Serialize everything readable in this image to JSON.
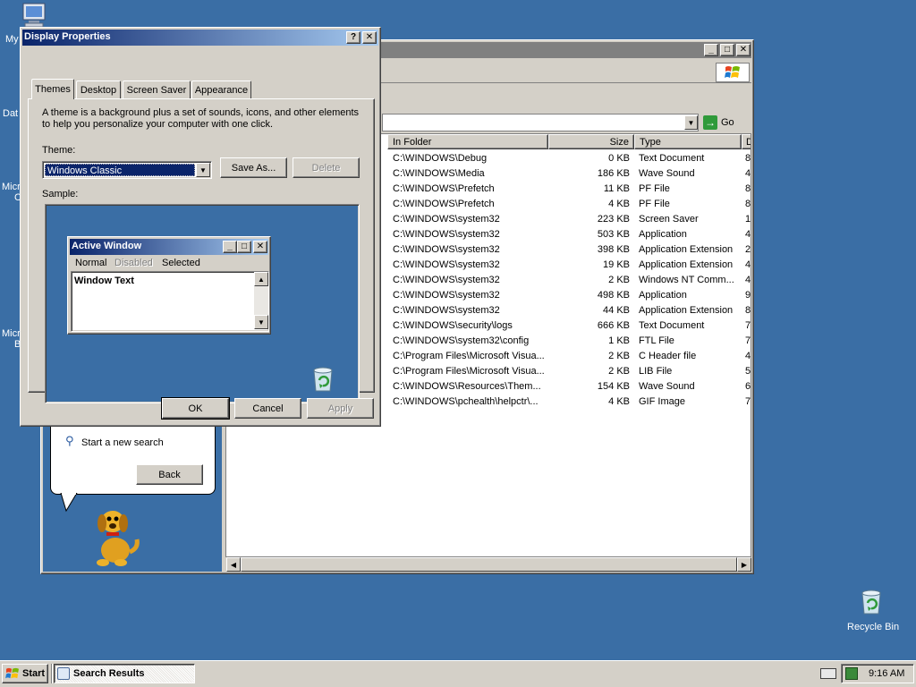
{
  "desktop": {
    "icons": [
      {
        "label": "My",
        "name": "my-computer"
      },
      {
        "label": "Dat",
        "name": "data"
      },
      {
        "label": "Micr",
        "label2": "C",
        "name": "microsoft-1"
      },
      {
        "label": "Micr",
        "label2": "B",
        "name": "microsoft-2"
      },
      {
        "label": "Recycle Bin",
        "name": "recycle-bin"
      }
    ]
  },
  "search_window": {
    "go_label": "Go",
    "columns": {
      "in_folder": "In Folder",
      "size": "Size",
      "type": "Type",
      "d": "D"
    },
    "rows": [
      {
        "folder": "C:\\WINDOWS\\Debug",
        "size": "0 KB",
        "type": "Text Document",
        "d": "8"
      },
      {
        "folder": "C:\\WINDOWS\\Media",
        "size": "186 KB",
        "type": "Wave Sound",
        "d": "4"
      },
      {
        "folder": "C:\\WINDOWS\\Prefetch",
        "size": "11 KB",
        "type": "PF File",
        "d": "8"
      },
      {
        "folder": "C:\\WINDOWS\\Prefetch",
        "size": "4 KB",
        "type": "PF File",
        "d": "8"
      },
      {
        "folder": "C:\\WINDOWS\\system32",
        "size": "223 KB",
        "type": "Screen Saver",
        "d": "1"
      },
      {
        "folder": "C:\\WINDOWS\\system32",
        "size": "503 KB",
        "type": "Application",
        "d": "4"
      },
      {
        "folder": "C:\\WINDOWS\\system32",
        "size": "398 KB",
        "type": "Application Extension",
        "d": "2"
      },
      {
        "folder": "C:\\WINDOWS\\system32",
        "size": "19 KB",
        "type": "Application Extension",
        "d": "4"
      },
      {
        "folder": "C:\\WINDOWS\\system32",
        "size": "2 KB",
        "type": "Windows NT Comm...",
        "d": "4"
      },
      {
        "folder": "C:\\WINDOWS\\system32",
        "size": "498 KB",
        "type": "Application",
        "d": "9"
      },
      {
        "folder": "C:\\WINDOWS\\system32",
        "size": "44 KB",
        "type": "Application Extension",
        "d": "8"
      },
      {
        "folder": "C:\\WINDOWS\\security\\logs",
        "size": "666 KB",
        "type": "Text Document",
        "d": "7"
      },
      {
        "folder": "C:\\WINDOWS\\system32\\config",
        "size": "1 KB",
        "type": "FTL File",
        "d": "7"
      },
      {
        "folder": "C:\\Program Files\\Microsoft Visua...",
        "size": "2 KB",
        "type": "C Header file",
        "d": "4"
      },
      {
        "folder": "C:\\Program Files\\Microsoft Visua...",
        "size": "2 KB",
        "type": "LIB File",
        "d": "5"
      },
      {
        "folder": "C:\\WINDOWS\\Resources\\Them...",
        "size": "154 KB",
        "type": "Wave Sound",
        "d": "6"
      },
      {
        "folder": "C:\\WINDOWS\\pchealth\\helpctr\\...",
        "size": "4 KB",
        "type": "GIF Image",
        "d": "7"
      }
    ],
    "assistant": {
      "new_search": "Start a new search",
      "back": "Back"
    }
  },
  "dialog": {
    "title": "Display Properties",
    "help_btn": "?",
    "close_btn": "✕",
    "tabs": [
      "Themes",
      "Desktop",
      "Screen Saver",
      "Appearance"
    ],
    "description": "A theme is a background plus a set of sounds, icons, and other elements to help you personalize your computer with one click.",
    "theme_label": "Theme:",
    "theme_value": "Windows Classic",
    "save_as": "Save As...",
    "delete": "Delete",
    "sample_label": "Sample:",
    "sample": {
      "title": "Active Window",
      "menu": [
        "Normal",
        "Disabled",
        "Selected"
      ],
      "text": "Window Text"
    },
    "ok": "OK",
    "cancel": "Cancel",
    "apply": "Apply"
  },
  "taskbar": {
    "start": "Start",
    "task": "Search Results",
    "time": "9:16 AM"
  },
  "colors": {
    "desktop": "#3a6ea5",
    "titlebar": "#0a246a",
    "face": "#d4d0c8",
    "selection": "#0a246a"
  }
}
